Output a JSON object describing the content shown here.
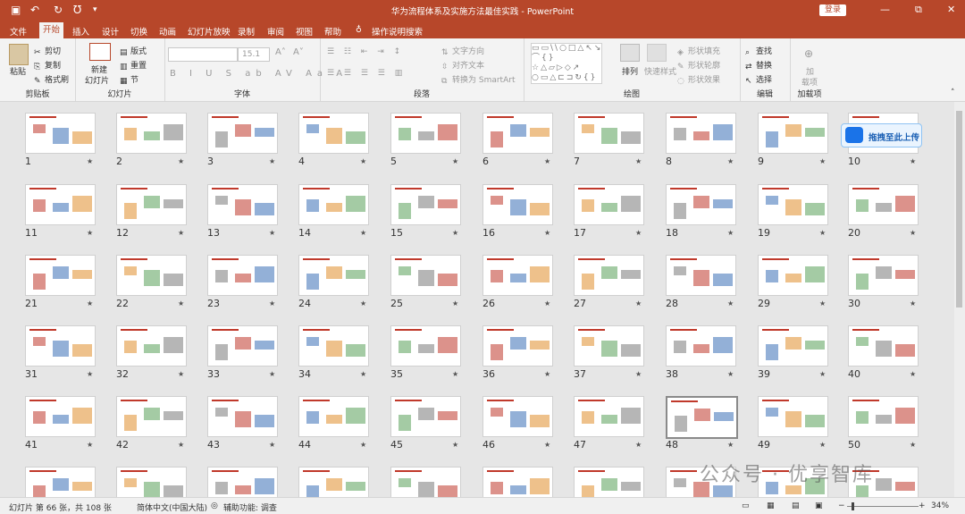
{
  "app": {
    "title": "华为流程体系及实施方法最佳实践 - PowerPoint",
    "login_label": "登录"
  },
  "menu": {
    "tabs": [
      "文件",
      "开始",
      "插入",
      "设计",
      "切换",
      "动画",
      "幻灯片放映",
      "录制",
      "审阅",
      "视图",
      "帮助"
    ],
    "active_tab": "开始",
    "tell_me": "操作说明搜索"
  },
  "ribbon": {
    "clipboard": {
      "paste": "粘贴",
      "cut": "剪切",
      "copy": "复制",
      "format_painter": "格式刷",
      "label": "剪贴板"
    },
    "slides": {
      "new_slide": "新建",
      "new_slide_2": "幻灯片",
      "layout": "版式",
      "reset": "重置",
      "section": "节",
      "label": "幻灯片"
    },
    "font": {
      "size": "15.1",
      "label": "字体"
    },
    "paragraph": {
      "text_direction": "文字方向",
      "align_text": "对齐文本",
      "smartart": "转换为 SmartArt",
      "label": "段落"
    },
    "drawing": {
      "arrange": "排列",
      "quick_styles": "快速样式",
      "shape_fill": "形状填充",
      "shape_outline": "形状轮廓",
      "shape_effects": "形状效果",
      "label": "绘图"
    },
    "editing": {
      "find": "查找",
      "replace": "替换",
      "select": "选择",
      "label": "编辑"
    },
    "addins": {
      "addin": "加",
      "addin_2": "载项",
      "label": "加载项"
    }
  },
  "slides": {
    "count_visible": 50,
    "selected": 48,
    "numbers": [
      "1",
      "2",
      "3",
      "4",
      "5",
      "6",
      "7",
      "8",
      "9",
      "10",
      "11",
      "12",
      "13",
      "14",
      "15",
      "16",
      "17",
      "18",
      "19",
      "20",
      "21",
      "22",
      "23",
      "24",
      "25",
      "26",
      "27",
      "28",
      "29",
      "30",
      "31",
      "32",
      "33",
      "34",
      "35",
      "36",
      "37",
      "38",
      "39",
      "40",
      "41",
      "42",
      "43",
      "44",
      "45",
      "46",
      "47",
      "48",
      "49",
      "50"
    ]
  },
  "upload_badge": "拖拽至此上传",
  "watermark": "公众号 · 优享智库",
  "status": {
    "slide_info": "幻灯片 第 66 张，共 108 张",
    "language": "简体中文(中国大陆)",
    "accessibility": "辅助功能: 调查",
    "zoom": "34%"
  },
  "colors": {
    "brand": "#b7472a",
    "accent_red": "#c0392b",
    "ribbon_bg": "#f3f3f3"
  }
}
